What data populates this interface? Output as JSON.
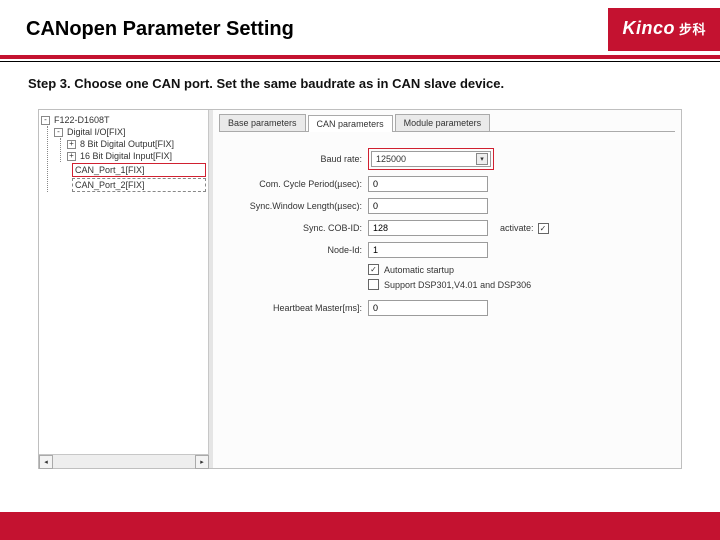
{
  "header": {
    "title": "CANopen Parameter Setting",
    "brand": "Kinco",
    "brand_cn": "步科"
  },
  "instruction": "Step 3. Choose one CAN port. Set the same baudrate as in CAN slave device.",
  "tree": {
    "root": "F122-D1608T",
    "io_group": "Digital I/O[FIX]",
    "out8": "8 Bit Digital Output[FIX]",
    "in16": "16 Bit Digital Input[FIX]",
    "can1": "CAN_Port_1[FIX]",
    "can2": "CAN_Port_2[FIX]"
  },
  "tabs": {
    "base": "Base parameters",
    "can": "CAN parameters",
    "module": "Module parameters"
  },
  "form": {
    "baud_label": "Baud rate:",
    "baud_value": "125000",
    "com_label": "Com. Cycle Period(µsec):",
    "com_value": "0",
    "sync_label": "Sync.Window Length(µsec):",
    "sync_value": "0",
    "cob_label": "Sync. COB-ID:",
    "cob_value": "128",
    "activate_label": "activate:",
    "node_label": "Node-Id:",
    "node_value": "1",
    "auto_label": "Automatic startup",
    "dsp_label": "Support DSP301,V4.01 and DSP306",
    "heartbeat_label": "Heartbeat Master[ms]:",
    "heartbeat_value": "0"
  }
}
